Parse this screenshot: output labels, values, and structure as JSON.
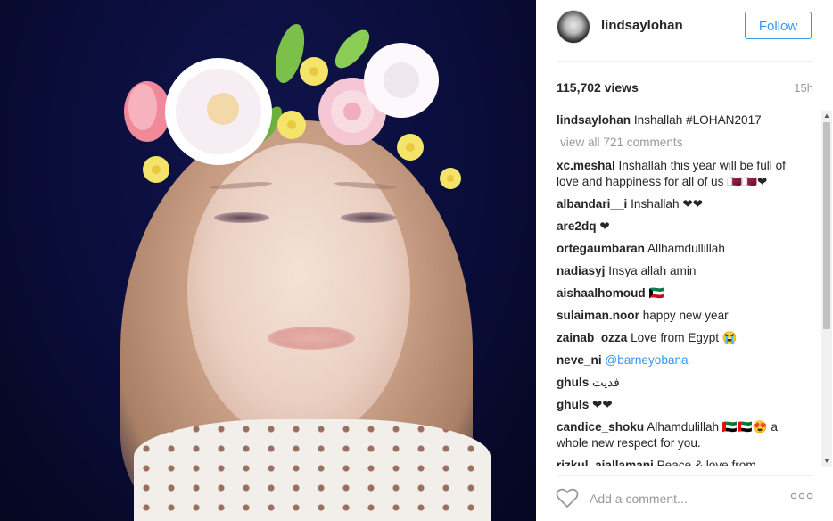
{
  "post": {
    "username": "lindsaylohan",
    "follow_label": "Follow",
    "views": "115,702 views",
    "timestamp": "15h",
    "caption_user": "lindsaylohan",
    "caption_text": "Inshallah #LOHAN2017",
    "view_all_label": "view all 721 comments"
  },
  "comments": [
    {
      "user": "xc.meshal",
      "text": "Inshallah this year will be full of love and happiness for all of us 🇶🇦🇶🇦❤"
    },
    {
      "user": "albandari__i",
      "text": "Inshallah ❤❤"
    },
    {
      "user": "are2dq",
      "text": "❤"
    },
    {
      "user": "ortegaumbaran",
      "text": "Allhamdullillah"
    },
    {
      "user": "nadiasyj",
      "text": "Insya allah amin"
    },
    {
      "user": "aishaalhomoud",
      "text": "🇰🇼"
    },
    {
      "user": "sulaiman.noor",
      "text": "happy new year"
    },
    {
      "user": "zainab_ozza",
      "text": "Love from Egypt 😭"
    },
    {
      "user": "neve_ni",
      "text": "@barneyobana"
    },
    {
      "user": "ghuls",
      "text": "فديت"
    },
    {
      "user": "ghuls",
      "text": "❤❤"
    },
    {
      "user": "candice_shoku",
      "text": "Alhamdulillah 🇦🇪🇦🇪😍 a whole new respect for you."
    },
    {
      "user": "rizkul_aiallamani",
      "text": "Peace & love from"
    }
  ],
  "footer": {
    "comment_placeholder": "Add a comment..."
  },
  "icons": {
    "heart": "heart-icon",
    "more": "more-options-icon"
  },
  "colors": {
    "accent": "#3897f0",
    "muted": "#999999"
  }
}
